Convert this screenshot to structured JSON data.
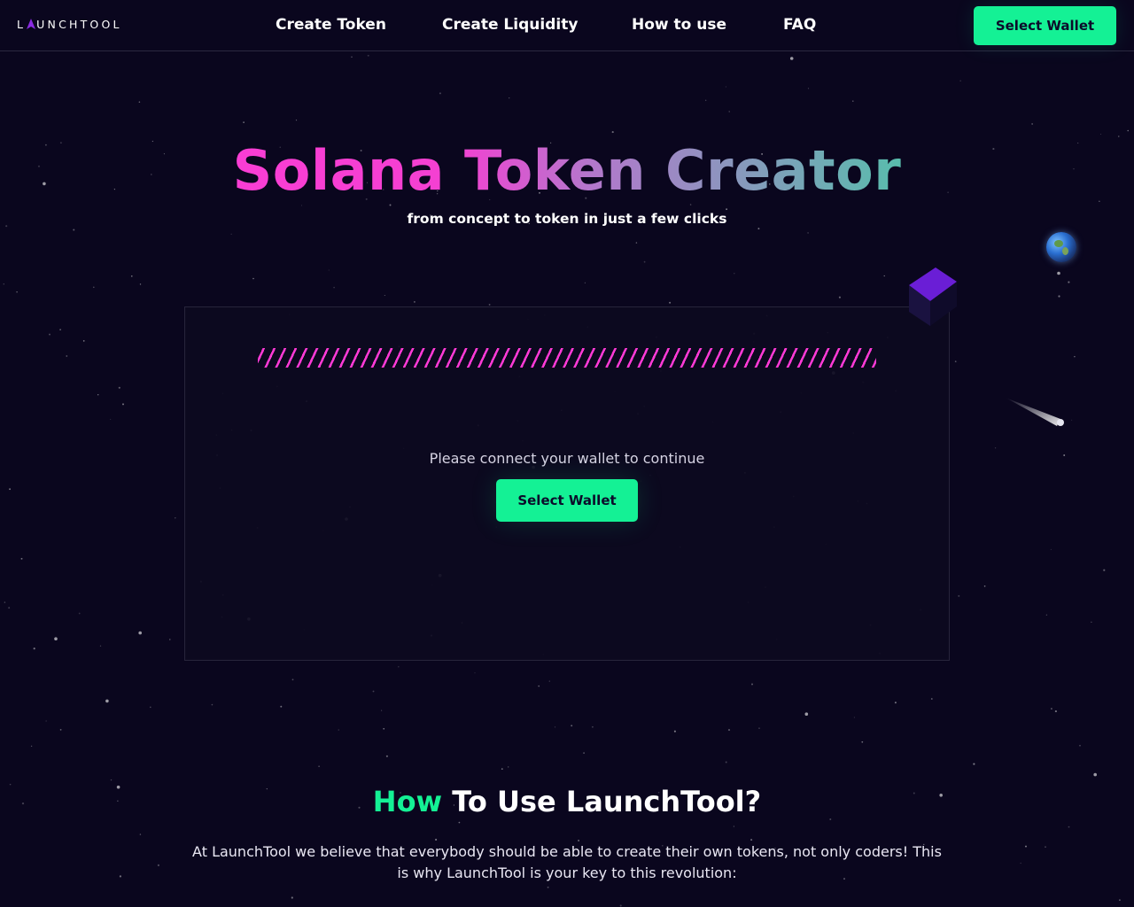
{
  "brand": {
    "logo_left": "L",
    "logo_right": "UNCHTOOL",
    "accent_color": "#8a2be2"
  },
  "nav": {
    "links": [
      {
        "label": "Create Token"
      },
      {
        "label": "Create Liquidity"
      },
      {
        "label": "How to use"
      },
      {
        "label": "FAQ"
      }
    ],
    "wallet_button": "Select Wallet"
  },
  "hero": {
    "title": "Solana Token Creator",
    "subtitle": "from concept to token in just a few clicks"
  },
  "card": {
    "prompt": "Please connect your wallet to continue",
    "wallet_button": "Select Wallet"
  },
  "how": {
    "title_accent": "How",
    "title_rest": " To Use LaunchTool?",
    "description": "At LaunchTool we believe that everybody should be able to create their own tokens, not only coders! This is why LaunchTool is your key to this revolution:"
  },
  "colors": {
    "background": "#0a061e",
    "primary_green": "#14f195",
    "primary_pink": "#ff3ad6"
  },
  "decorations": [
    "earth-icon",
    "cube-icon",
    "comet-icon",
    "starfield"
  ]
}
